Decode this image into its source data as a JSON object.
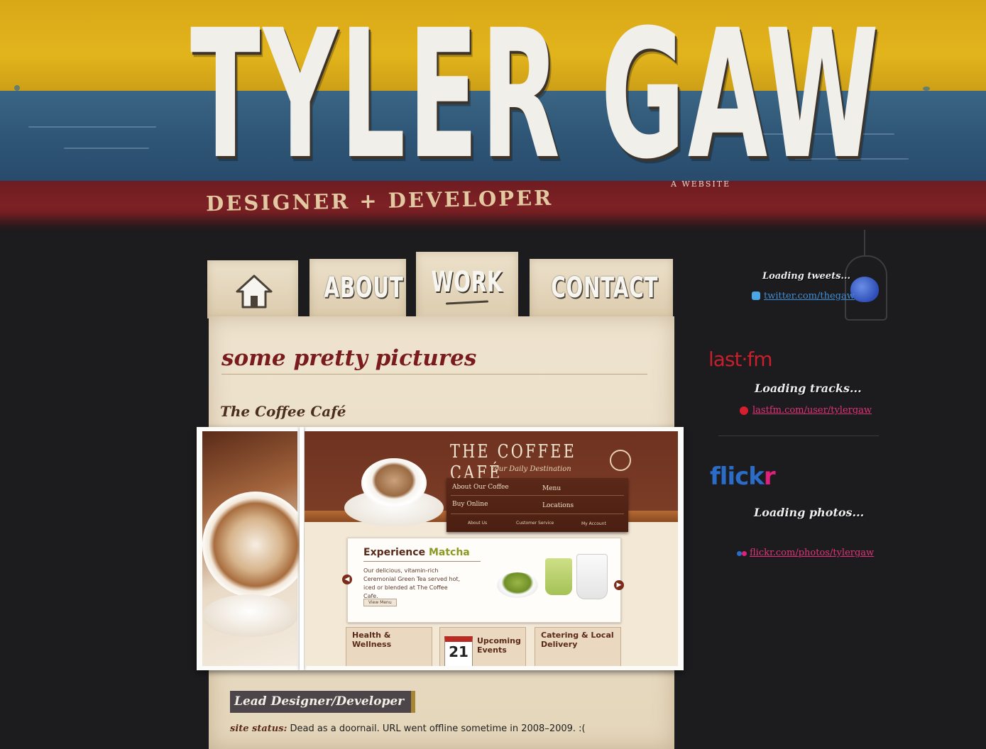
{
  "header": {
    "site_name": "TYLER GAW",
    "tagline": "DESIGNER + DEVELOPER",
    "sub_label": "A WEBSITE"
  },
  "nav": {
    "tabs": [
      {
        "label": "",
        "icon": "home-icon",
        "active": false
      },
      {
        "label": "ABOUT",
        "active": false
      },
      {
        "label": "WORK",
        "active": true
      },
      {
        "label": "CONTACT",
        "active": false
      }
    ]
  },
  "main": {
    "page_title": "some pretty pictures",
    "project_title": "The Coffee Café",
    "screenshot": {
      "site_name": "THE COFFEE CAFÉ",
      "slogan": "Your Daily Destination",
      "nav_items": [
        "About Our Coffee",
        "Menu",
        "Buy Online",
        "Locations"
      ],
      "sub_nav": [
        "About Us",
        "Customer Service",
        "My Account"
      ],
      "feature_title_1": "Experience",
      "feature_title_2": "Matcha",
      "feature_text": "Our delicious, vitamin-rich Ceremonial Green Tea served hot, iced or blended at The Coffee Cafe.",
      "feature_button": "View Menu",
      "boxes": [
        {
          "label": "Health & Wellness"
        },
        {
          "label": "Upcoming Events",
          "calendar_day": "21"
        },
        {
          "label": "Catering & Local Delivery"
        }
      ]
    },
    "role": "Lead Designer/Developer",
    "status_label": "site status:",
    "status_text": "Dead as a doornail. URL went offline sometime in 2008–2009. :("
  },
  "sidebar": {
    "twitter": {
      "loading": "Loading tweets...",
      "link": "twitter.com/thegaw",
      "link_color": "#3f8fd6"
    },
    "lastfm": {
      "brand": "last·fm",
      "loading": "Loading tracks...",
      "link": "lastfm.com/user/tylergaw",
      "link_color": "#e0347a"
    },
    "flickr": {
      "brand_blue": "flick",
      "brand_pink": "r",
      "loading": "Loading photos...",
      "link": "flickr.com/photos/tylergaw",
      "link_color": "#e0347a"
    }
  },
  "colors": {
    "banner_yellow": "#e2b41c",
    "banner_blue": "#2f5676",
    "banner_red": "#7d2125",
    "page_bg": "#1c1b1d",
    "panel_bg": "#eee3cf",
    "title_red": "#7a1c1e"
  }
}
